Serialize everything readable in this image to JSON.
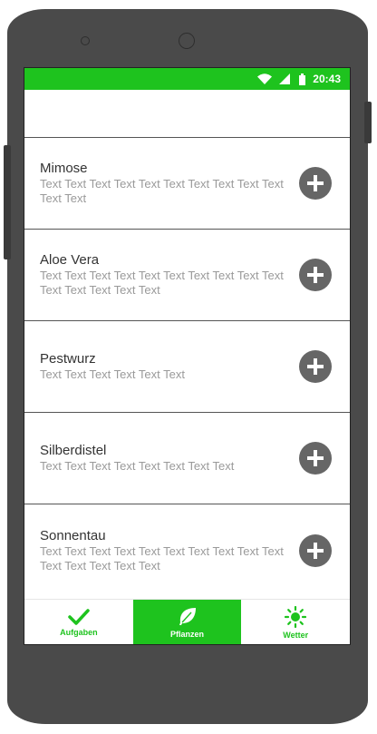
{
  "status_bar": {
    "time": "20:43"
  },
  "items": [
    {
      "title": "Mimose",
      "desc": "Text Text Text Text Text Text Text Text Text Text Text Text"
    },
    {
      "title": "Aloe Vera",
      "desc": "Text Text Text Text Text Text Text Text Text Text Text Text Text Text Text"
    },
    {
      "title": "Pestwurz",
      "desc": "Text Text Text Text Text Text"
    },
    {
      "title": "Silberdistel",
      "desc": "Text Text Text Text Text Text Text Text"
    },
    {
      "title": "Sonnentau",
      "desc": "Text Text Text Text Text Text Text Text Text Text Text Text Text Text Text"
    }
  ],
  "tabs": [
    {
      "label": "Aufgaben",
      "icon": "checkmark-icon"
    },
    {
      "label": "Pflanzen",
      "icon": "leaf-icon",
      "active": true
    },
    {
      "label": "Wetter",
      "icon": "sun-icon"
    }
  ],
  "colors": {
    "accent": "#1ec31e",
    "button": "#666666"
  }
}
